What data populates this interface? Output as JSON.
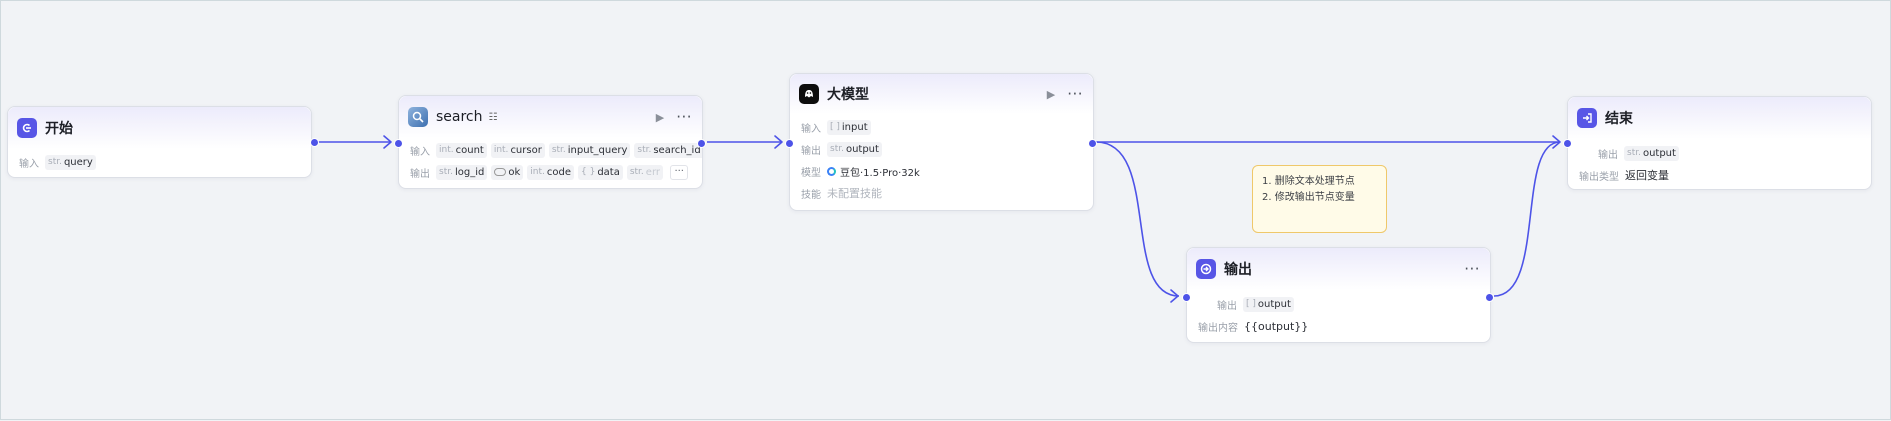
{
  "colors": {
    "accent": "#4d53e8",
    "note_border": "#efc86a",
    "note_bg": "#fffbe8"
  },
  "start": {
    "title": "开始",
    "icon": "start-icon",
    "input_label": "输入",
    "inputs": [
      {
        "type": "str.",
        "name": "query"
      }
    ]
  },
  "search": {
    "title": "search",
    "icon": "search-plugin-icon",
    "input_label": "输入",
    "inputs": [
      {
        "type": "int.",
        "name": "count"
      },
      {
        "type": "int.",
        "name": "cursor"
      },
      {
        "type": "str.",
        "name": "input_query"
      },
      {
        "type": "str.",
        "name": "search_id"
      }
    ],
    "output_label": "输出",
    "outputs": [
      {
        "type": "str.",
        "name": "log_id"
      },
      {
        "type": "",
        "name": "ok"
      },
      {
        "type": "int.",
        "name": "code"
      },
      {
        "type": "{ }",
        "name": "data"
      },
      {
        "type": "str.",
        "name": "err"
      }
    ],
    "more": "···"
  },
  "llm": {
    "title": "大模型",
    "input_label": "输入",
    "input": {
      "type": "[ ]",
      "name": "input"
    },
    "output_label": "输出",
    "output": {
      "type": "str.",
      "name": "output"
    },
    "model_label": "模型",
    "model": "豆包·1.5·Pro·32k",
    "skill_label": "技能",
    "skill": "未配置技能"
  },
  "note": {
    "lines": [
      "1. 删除文本处理节点",
      "2. 修改输出节点变量"
    ]
  },
  "output": {
    "title": "输出",
    "output_label": "输出",
    "output": {
      "type": "[ ]",
      "name": "output"
    },
    "content_label": "输出内容",
    "content": "{{output}}"
  },
  "end": {
    "title": "结束",
    "output_label": "输出",
    "output": {
      "type": "str.",
      "name": "output"
    },
    "type_label": "输出类型",
    "type_value": "返回变量"
  }
}
